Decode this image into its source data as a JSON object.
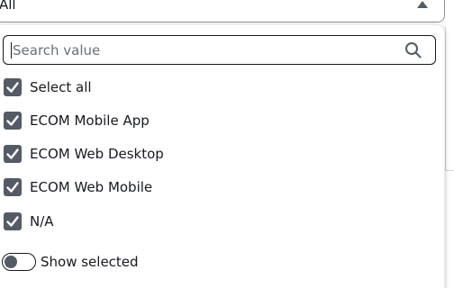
{
  "select": {
    "value": "All",
    "caret_icon": "caret-up-icon"
  },
  "search": {
    "value": "",
    "placeholder": "Search value",
    "icon": "search-icon"
  },
  "options": [
    {
      "label": "Select all",
      "checked": true
    },
    {
      "label": "ECOM Mobile App",
      "checked": true
    },
    {
      "label": "ECOM Web Desktop",
      "checked": true
    },
    {
      "label": "ECOM Web Mobile",
      "checked": true
    },
    {
      "label": "N/A",
      "checked": true
    }
  ],
  "toggle": {
    "label": "Show selected",
    "on": false
  },
  "colors": {
    "checkbox_fill": "#545b64",
    "text": "#16191f",
    "border": "#8d9096"
  }
}
